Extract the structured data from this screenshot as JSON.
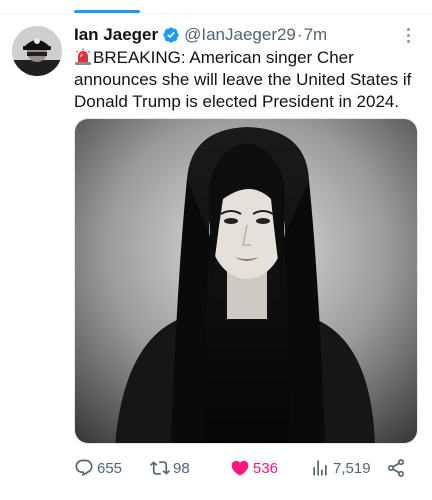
{
  "tweet": {
    "author_name": "Ian Jaeger",
    "handle": "@IanJaeger29",
    "separator": "·",
    "time": "7m",
    "text": "BREAKING: American singer Cher announces she will leave the United States if Donald Trump is elected President in 2024.",
    "emoji_icon": "police-siren-icon",
    "verified_icon": "verified-badge-icon"
  },
  "actions": {
    "replies": "655",
    "retweets": "98",
    "likes": "536",
    "views": "7,519"
  },
  "colors": {
    "accent": "#1d9bf0",
    "like": "#f91880",
    "secondary_text": "#536471"
  }
}
